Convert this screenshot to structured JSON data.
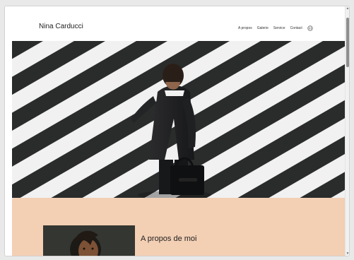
{
  "header": {
    "site_title": "Nina Carducci",
    "nav": [
      "A propos",
      "Galerie",
      "Service",
      "Contact"
    ],
    "language_icon": "globe-icon"
  },
  "hero": {
    "image": "businessman-crossing-street-photo"
  },
  "about": {
    "heading": "A propos de moi",
    "photo": "woman-portrait-photo"
  },
  "colors": {
    "about_background": "#f3cfb4",
    "text": "#222222"
  }
}
